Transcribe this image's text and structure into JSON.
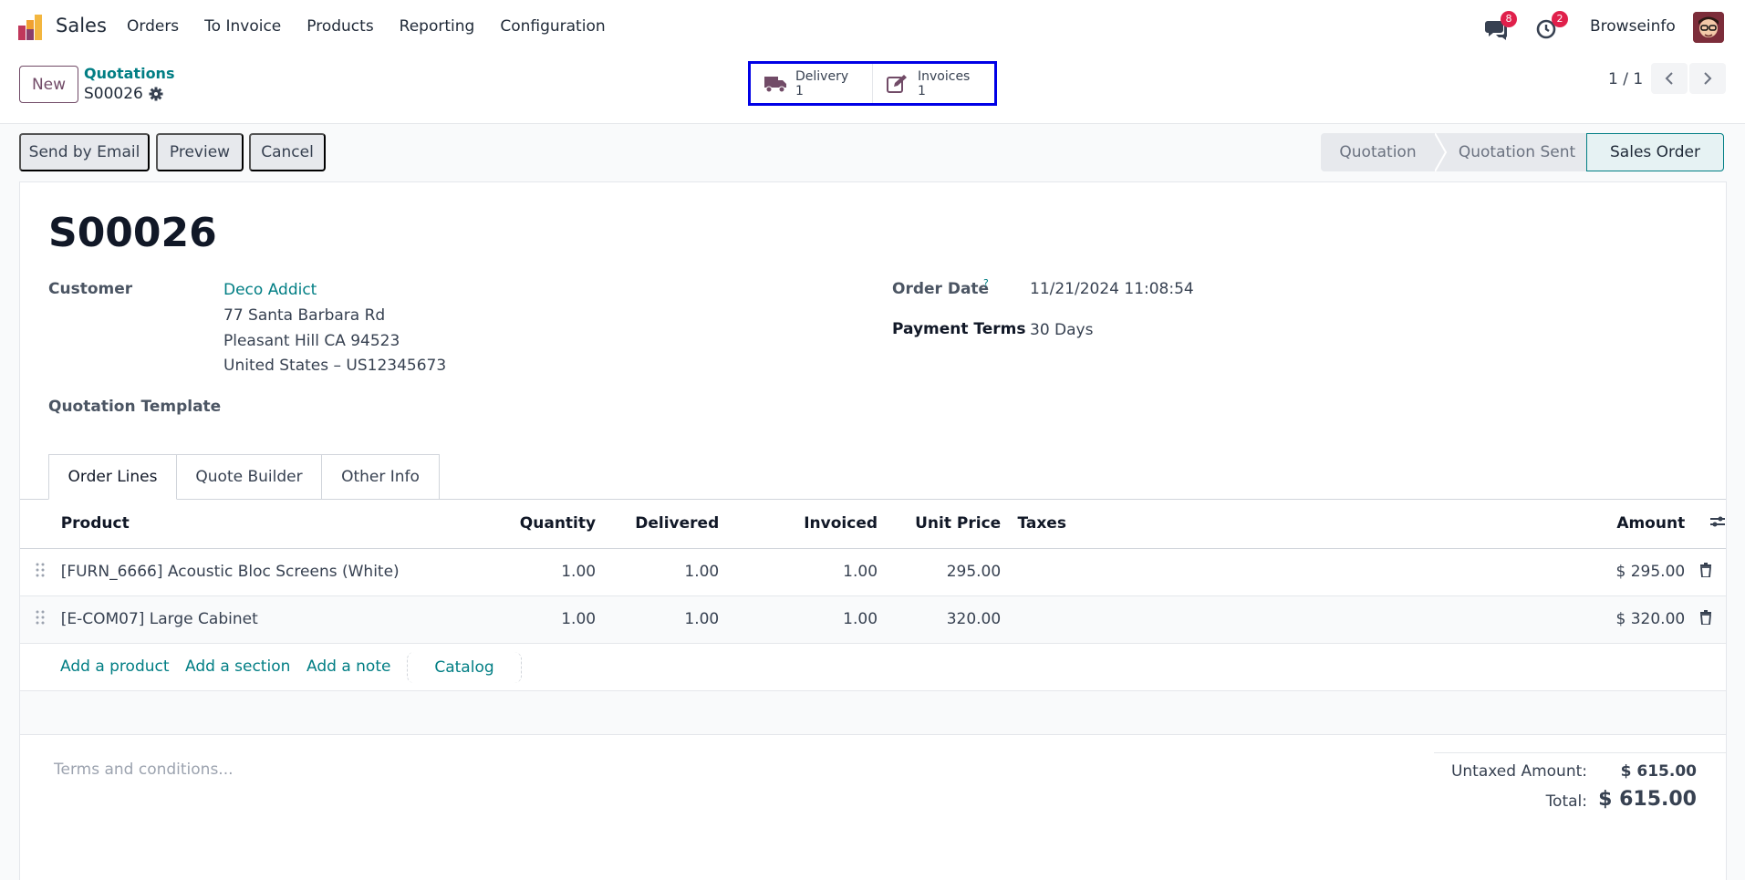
{
  "nav": {
    "app_name": "Sales",
    "menu": [
      "Orders",
      "To Invoice",
      "Products",
      "Reporting",
      "Configuration"
    ],
    "messages_count": "8",
    "activities_count": "2",
    "company": "Browseinfo"
  },
  "control": {
    "new_label": "New",
    "breadcrumb": "Quotations",
    "record_name": "S00026",
    "smart_buttons": [
      {
        "label": "Delivery",
        "count": "1",
        "icon": "truck-icon"
      },
      {
        "label": "Invoices",
        "count": "1",
        "icon": "edit-invoice-icon"
      }
    ],
    "pager": "1 / 1"
  },
  "actions": {
    "send_email": "Send by Email",
    "preview": "Preview",
    "cancel": "Cancel"
  },
  "status_bar": {
    "stages": [
      "Quotation",
      "Quotation Sent",
      "Sales Order"
    ],
    "active": "Sales Order"
  },
  "form": {
    "title": "S00026",
    "customer_label": "Customer",
    "customer_name": "Deco Addict",
    "address_line1": "77 Santa Barbara Rd",
    "address_line2": "Pleasant Hill CA 94523",
    "address_line3": "United States – US12345673",
    "template_label": "Quotation Template",
    "order_date_label": "Order Date",
    "order_date_help": "?",
    "order_date": "11/21/2024 11:08:54",
    "payment_terms_label": "Payment Terms",
    "payment_terms": "30 Days"
  },
  "tabs": [
    "Order Lines",
    "Quote Builder",
    "Other Info"
  ],
  "table": {
    "headers": {
      "product": "Product",
      "quantity": "Quantity",
      "delivered": "Delivered",
      "invoiced": "Invoiced",
      "unit_price": "Unit Price",
      "taxes": "Taxes",
      "amount": "Amount"
    },
    "rows": [
      {
        "product": "[FURN_6666] Acoustic Bloc Screens (White)",
        "quantity": "1.00",
        "delivered": "1.00",
        "invoiced": "1.00",
        "unit_price": "295.00",
        "taxes": "",
        "amount": "$ 295.00"
      },
      {
        "product": "[E-COM07] Large Cabinet",
        "quantity": "1.00",
        "delivered": "1.00",
        "invoiced": "1.00",
        "unit_price": "320.00",
        "taxes": "",
        "amount": "$ 320.00"
      }
    ],
    "add_product": "Add a product",
    "add_section": "Add a section",
    "add_note": "Add a note",
    "catalog": "Catalog"
  },
  "footer": {
    "terms_placeholder": "Terms and conditions...",
    "untaxed_label": "Untaxed Amount:",
    "untaxed_value": "$ 615.00",
    "total_label": "Total:",
    "total_value": "$ 615.00"
  },
  "colors": {
    "brand": "#714b67",
    "link": "#017e84",
    "badge": "#e0204b",
    "highlight_box": "#0000e6"
  }
}
